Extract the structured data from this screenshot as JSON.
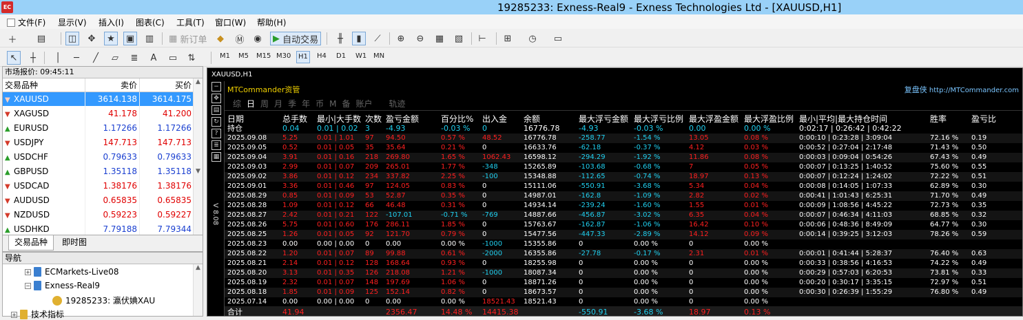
{
  "titlebar": {
    "app_icon": "EC",
    "title": "19285233: Exness-Real9 - Exness Technologies Ltd - [XAUUSD,H1]"
  },
  "menu": [
    "文件(F)",
    "显示(V)",
    "插入(I)",
    "图表(C)",
    "工具(T)",
    "窗口(W)",
    "帮助(H)"
  ],
  "toolbar1": {
    "new_order": "新订单",
    "auto_trade": "自动交易"
  },
  "toolbar2": {
    "letter_a": "A",
    "timeframes": [
      "M1",
      "M5",
      "M15",
      "M30",
      "H1",
      "H4",
      "D1",
      "W1",
      "MN"
    ],
    "active_timeframe": "H1"
  },
  "market_watch": {
    "title": "市场报价: 09:45:11",
    "columns": [
      "交易品种",
      "卖价",
      "买价"
    ],
    "rows": [
      {
        "symbol": "XAUUSD",
        "bid": "3614.138",
        "ask": "3614.175",
        "dir": "down"
      },
      {
        "symbol": "XAGUSD",
        "bid": "41.178",
        "ask": "41.200",
        "dir": "down"
      },
      {
        "symbol": "EURUSD",
        "bid": "1.17266",
        "ask": "1.17266",
        "dir": "up"
      },
      {
        "symbol": "USDJPY",
        "bid": "147.713",
        "ask": "147.713",
        "dir": "down"
      },
      {
        "symbol": "USDCHF",
        "bid": "0.79633",
        "ask": "0.79633",
        "dir": "up"
      },
      {
        "symbol": "GBPUSD",
        "bid": "1.35118",
        "ask": "1.35118",
        "dir": "up"
      },
      {
        "symbol": "USDCAD",
        "bid": "1.38176",
        "ask": "1.38176",
        "dir": "down"
      },
      {
        "symbol": "AUDUSD",
        "bid": "0.65835",
        "ask": "0.65835",
        "dir": "down"
      },
      {
        "symbol": "NZDUSD",
        "bid": "0.59223",
        "ask": "0.59227",
        "dir": "down"
      },
      {
        "symbol": "USDHKD",
        "bid": "7.79188",
        "ask": "7.79344",
        "dir": "up"
      }
    ],
    "tabs": [
      "交易品种",
      "即时图"
    ]
  },
  "navigator": {
    "title": "导航",
    "items": [
      "ECMarkets-Live08",
      "Exness-Real9",
      "19285233: 瀛伏婰XAU",
      "技术指标"
    ]
  },
  "chart": {
    "title": "XAUUSD,H1",
    "version_label": "V 8.08",
    "panel": {
      "brand": "MTCommander资管",
      "site_prefix": "复盘侠",
      "site_url": "http://MTCommander.com",
      "periods": [
        "综",
        "日",
        "周",
        "月",
        "季",
        "年",
        "币",
        "M",
        "备",
        "账户",
        "轨迹"
      ],
      "active_period": "日",
      "headers": [
        "日期",
        "总手数",
        "最小|大手数",
        "次数",
        "盈亏金额",
        "百分比%",
        "出入金",
        "余额",
        "最大浮亏金额",
        "最大浮亏比例",
        "最大浮盈金额",
        "最大浮盈比例",
        "最小|平均|最大持仓时间",
        "胜率",
        "盈亏比"
      ],
      "rows": [
        [
          "持仓",
          "0.04",
          "0.01 | 0.02",
          "3",
          "-4.93",
          "-0.03 %",
          "0",
          "16776.78",
          "-4.93",
          "-0.03 %",
          "0.00",
          "0.00 %",
          "0:02:17 | 0:26:42 | 0:42:22",
          "",
          ""
        ],
        [
          "2025.09.08",
          "5.25",
          "0.01 | 1.01",
          "97",
          "94.50",
          "0.57 %",
          "48.52",
          "16776.78",
          "-258.77",
          "-1.54 %",
          "13.05",
          "0.08 %",
          "0:00:10 | 0:23:28 | 3:09:04",
          "72.16 %",
          "0.19"
        ],
        [
          "2025.09.05",
          "0.52",
          "0.01 | 0.05",
          "35",
          "35.64",
          "0.21 %",
          "0",
          "16633.76",
          "-62.18",
          "-0.37 %",
          "4.12",
          "0.03 %",
          "0:00:52 | 0:27:04 | 2:17:48",
          "71.43 %",
          "0.50"
        ],
        [
          "2025.09.04",
          "3.91",
          "0.01 | 0.16",
          "218",
          "269.80",
          "1.65 %",
          "1062.43",
          "16598.12",
          "-294.29",
          "-1.92 %",
          "11.86",
          "0.08 %",
          "0:00:03 | 0:09:04 | 0:54:26",
          "67.43 %",
          "0.49"
        ],
        [
          "2025.09.03",
          "2.99",
          "0.01 | 0.07",
          "209",
          "265.01",
          "1.77 %",
          "-348",
          "15265.89",
          "-103.68",
          "-0.68 %",
          "7",
          "0.05 %",
          "0:00:07 | 0:13:25 | 1:40:52",
          "75.60 %",
          "0.55"
        ],
        [
          "2025.09.02",
          "3.86",
          "0.01 | 0.12",
          "234",
          "337.82",
          "2.25 %",
          "-100",
          "15348.88",
          "-112.65",
          "-0.74 %",
          "18.97",
          "0.13 %",
          "0:00:07 | 0:12:24 | 1:24:02",
          "72.22 %",
          "0.51"
        ],
        [
          "2025.09.01",
          "3.36",
          "0.01 | 0.46",
          "97",
          "124.05",
          "0.83 %",
          "0",
          "15111.06",
          "-550.91",
          "-3.68 %",
          "5.34",
          "0.04 %",
          "0:00:08 | 0:14:05 | 1:07:33",
          "62.89 %",
          "0.30"
        ],
        [
          "2025.08.29",
          "0.85",
          "0.01 | 0.09",
          "53",
          "52.87",
          "0.35 %",
          "0",
          "14987.01",
          "-162.8",
          "-1.09 %",
          "2.82",
          "0.02 %",
          "0:00:41 | 1:01:43 | 6:25:31",
          "71.70 %",
          "0.49"
        ],
        [
          "2025.08.28",
          "1.09",
          "0.01 | 0.12",
          "66",
          "46.48",
          "0.31 %",
          "0",
          "14934.14",
          "-239.24",
          "-1.60 %",
          "1.55",
          "0.01 %",
          "0:00:09 | 1:08:56 | 4:45:22",
          "72.73 %",
          "0.35"
        ],
        [
          "2025.08.27",
          "2.42",
          "0.01 | 0.21",
          "122",
          "-107.01",
          "-0.71 %",
          "-769",
          "14887.66",
          "-456.87",
          "-3.02 %",
          "6.35",
          "0.04 %",
          "0:00:07 | 0:46:34 | 4:11:03",
          "68.85 %",
          "0.32"
        ],
        [
          "2025.08.26",
          "5.75",
          "0.01 | 0.60",
          "176",
          "286.11",
          "1.85 %",
          "0",
          "15763.67",
          "-162.87",
          "-1.06 %",
          "16.42",
          "0.10 %",
          "0:00:06 | 0:48:36 | 8:49:09",
          "64.77 %",
          "0.30"
        ],
        [
          "2025.08.25",
          "1.26",
          "0.01 | 0.05",
          "92",
          "121.70",
          "0.79 %",
          "0",
          "15477.56",
          "-447.33",
          "-2.89 %",
          "14.12",
          "0.09 %",
          "0:00:14 | 0:39:25 | 3:12:03",
          "78.26 %",
          "0.59"
        ],
        [
          "2025.08.23",
          "0.00",
          "0.00 | 0.00",
          "0",
          "0.00",
          "0.00 %",
          "-1000",
          "15355.86",
          "0",
          "0.00 %",
          "0",
          "0.00 %",
          "",
          "",
          ""
        ],
        [
          "2025.08.22",
          "1.20",
          "0.01 | 0.07",
          "89",
          "99.88",
          "0.61 %",
          "-2000",
          "16355.86",
          "-27.78",
          "-0.17 %",
          "2.31",
          "0.01 %",
          "0:00:01 | 0:41:44 | 5:28:37",
          "76.40 %",
          "0.63"
        ],
        [
          "2025.08.21",
          "2.14",
          "0.01 | 0.12",
          "128",
          "168.64",
          "0.93 %",
          "0",
          "18255.98",
          "0",
          "0.00 %",
          "0",
          "0.00 %",
          "0:00:33 | 0:38:56 | 4:16:53",
          "74.22 %",
          "0.49"
        ],
        [
          "2025.08.20",
          "3.13",
          "0.01 | 0.35",
          "126",
          "218.08",
          "1.21 %",
          "-1000",
          "18087.34",
          "0",
          "0.00 %",
          "0",
          "0.00 %",
          "0:00:29 | 0:57:03 | 6:20:53",
          "73.81 %",
          "0.33"
        ],
        [
          "2025.08.19",
          "2.32",
          "0.01 | 0.07",
          "148",
          "197.69",
          "1.06 %",
          "0",
          "18871.26",
          "0",
          "0.00 %",
          "0",
          "0.00 %",
          "0:00:20 | 0:30:17 | 3:35:15",
          "72.97 %",
          "0.51"
        ],
        [
          "2025.08.18",
          "1.85",
          "0.01 | 0.09",
          "125",
          "152.14",
          "0.82 %",
          "0",
          "18673.57",
          "0",
          "0.00 %",
          "0",
          "0.00 %",
          "0:00:30 | 0:26:39 | 1:55:29",
          "76.80 %",
          "0.49"
        ],
        [
          "2025.07.14",
          "0.00",
          "0.00 | 0.00",
          "0",
          "0.00",
          "0.00 %",
          "18521.43",
          "18521.43",
          "0",
          "0.00 %",
          "0",
          "0.00 %",
          "",
          "",
          ""
        ]
      ],
      "total": [
        "合计",
        "41.94",
        "",
        "",
        "2356.47",
        "14.48 %",
        "14415.38",
        "",
        "-550.91",
        "-3.68 %",
        "18.97",
        "0.13 %",
        "",
        "",
        ""
      ]
    }
  },
  "colors": {
    "titlebar": "#99d1f8",
    "selection": "#3399ff",
    "positive": "#ff2020",
    "negative": "#20d0f0",
    "brand": "#f0d000"
  }
}
